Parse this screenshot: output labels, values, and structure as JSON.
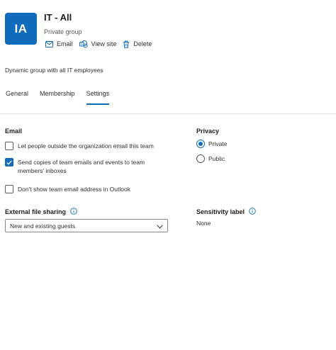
{
  "header": {
    "avatar_initials": "IA",
    "title": "IT - All",
    "subtitle": "Private group",
    "actions": [
      {
        "label": "Email",
        "icon": "mail-icon"
      },
      {
        "label": "View site",
        "icon": "sharepoint-icon"
      },
      {
        "label": "Delete",
        "icon": "trash-icon"
      }
    ]
  },
  "description": "Dynamic group with all IT employees",
  "tabs": [
    {
      "label": "General",
      "active": false
    },
    {
      "label": "Membership",
      "active": false
    },
    {
      "label": "Settings",
      "active": true
    }
  ],
  "email_section": {
    "heading": "Email",
    "options": [
      {
        "label": "Let people outside the organization email this team",
        "checked": false
      },
      {
        "label": "Send copies of team emails and events to team members' inboxes",
        "checked": true
      },
      {
        "label": "Don't show team email address in Outlook",
        "checked": false
      }
    ]
  },
  "privacy_section": {
    "heading": "Privacy",
    "options": [
      {
        "label": "Private",
        "selected": true
      },
      {
        "label": "Public",
        "selected": false
      }
    ]
  },
  "external_sharing": {
    "heading": "External file sharing",
    "selected_value": "New and existing guests"
  },
  "sensitivity": {
    "heading": "Sensitivity label",
    "value": "None"
  },
  "colors": {
    "accent": "#0f6cbd",
    "text": "#323130",
    "muted": "#605e5c",
    "divider": "#e1dfdd"
  }
}
